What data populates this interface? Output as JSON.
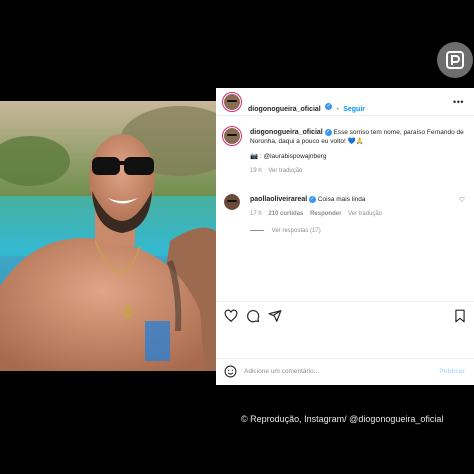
{
  "header": {
    "username": "diogonogueira_oficial",
    "verified_icon": "verified-badge-icon",
    "follow_separator": "•",
    "follow_label": "Seguir",
    "more_label": "•••"
  },
  "caption": {
    "username": "diogonogueira_oficial",
    "text": "Esse sorriso tem nome, paraíso Fernando de Noronha, daqui a pouco eu volto!",
    "emojis": "💙🙏",
    "tag_line": "📷 : @laurabispowajnberg",
    "time": "19 h",
    "translate": "Ver tradução"
  },
  "comment": {
    "username": "paollaoliveirareal",
    "text": "Coisa mais linda",
    "time": "17 h",
    "likes": "210 curtidas",
    "reply": "Responder",
    "translate": "Ver tradução",
    "view_replies": "Ver respostas (17)"
  },
  "add_comment": {
    "placeholder": "Adicione um comentário...",
    "publish": "Publicar"
  },
  "credit": "© Reprodução, Instagram/ @diogonogueira_oficial",
  "colors": {
    "accent": "#0095f6",
    "verified": "#3897f0",
    "muted": "#8e8e8e"
  }
}
